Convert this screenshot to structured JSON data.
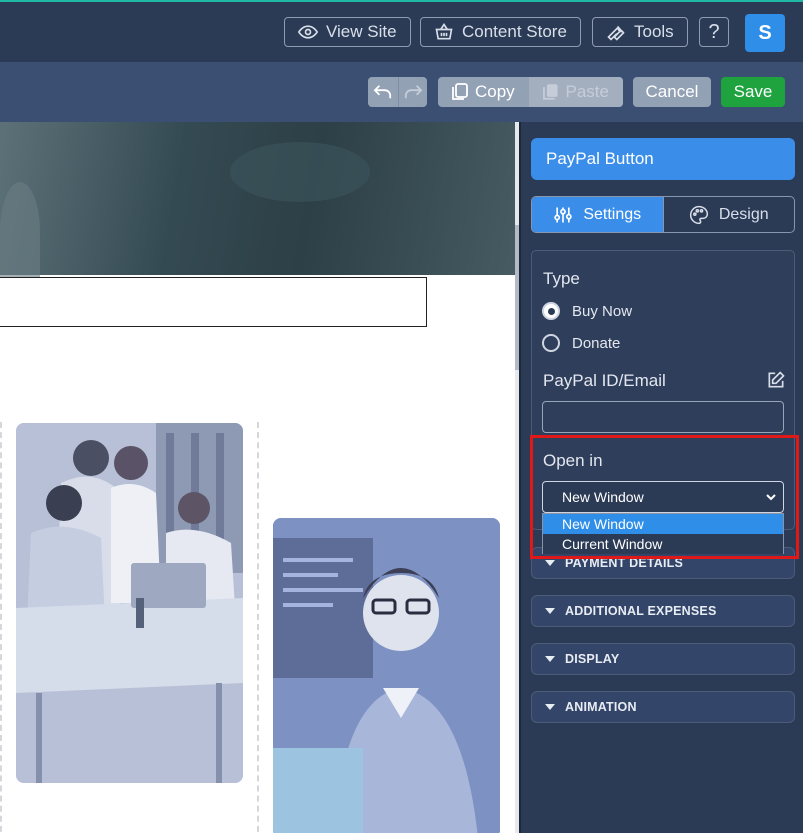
{
  "topbar": {
    "view_site": "View Site",
    "content_store": "Content Store",
    "tools": "Tools",
    "help": "?",
    "avatar_letter": "S",
    "accent_color": "#1fb7a6"
  },
  "toolbar": {
    "copy": "Copy",
    "paste": "Paste",
    "cancel": "Cancel",
    "save": "Save",
    "save_color": "#1ea33f"
  },
  "panel": {
    "title": "PayPal Button",
    "tabs": [
      {
        "label": "Settings",
        "icon": "sliders-icon",
        "active": true
      },
      {
        "label": "Design",
        "icon": "palette-icon",
        "active": false
      }
    ],
    "type_label": "Type",
    "type_options": [
      {
        "label": "Buy Now",
        "selected": true
      },
      {
        "label": "Donate",
        "selected": false
      }
    ],
    "paypal_id_label": "PayPal ID/Email",
    "paypal_id_value": "",
    "open_in_label": "Open in",
    "open_in_value": "New Window",
    "open_in_options": [
      "New Window",
      "Current Window"
    ],
    "sections": [
      "PAYMENT DETAILS",
      "ADDITIONAL EXPENSES",
      "DISPLAY",
      "ANIMATION"
    ],
    "accent_color": "#3a8eea"
  }
}
